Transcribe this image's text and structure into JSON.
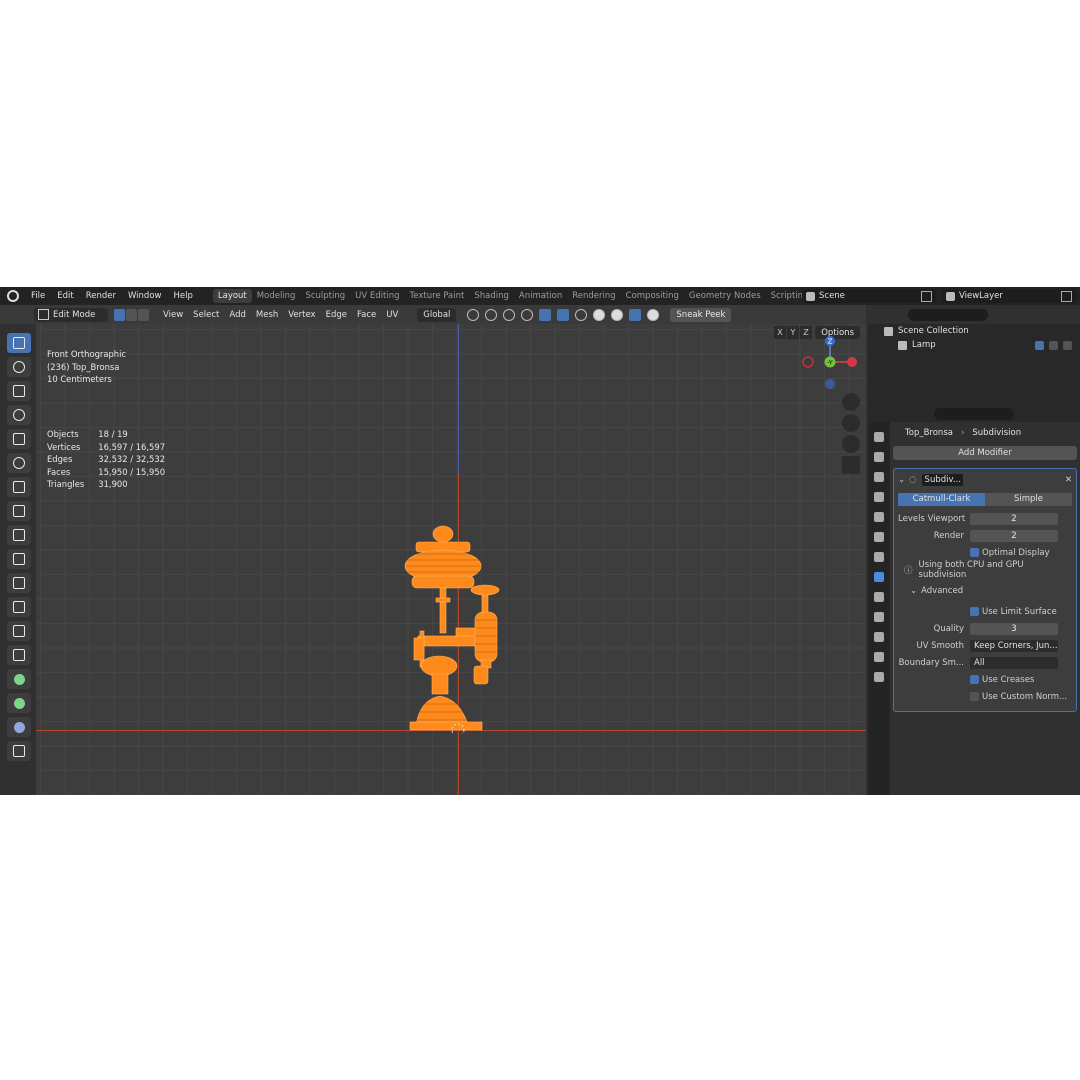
{
  "menu": {
    "items": [
      "File",
      "Edit",
      "Render",
      "Window",
      "Help"
    ]
  },
  "workspaces": [
    "Layout",
    "Modeling",
    "Sculpting",
    "UV Editing",
    "Texture Paint",
    "Shading",
    "Animation",
    "Rendering",
    "Compositing",
    "Geometry Nodes",
    "Scripting"
  ],
  "scene": {
    "name": "Scene"
  },
  "view_layer": {
    "name": "ViewLayer"
  },
  "header": {
    "mode": "Edit Mode",
    "menus": [
      "View",
      "Select",
      "Add",
      "Mesh",
      "Vertex",
      "Edge",
      "Face",
      "UV"
    ],
    "orientation": "Global",
    "sneak_peek": "Sneak Peek",
    "options": "Options",
    "axes": [
      "X",
      "Y",
      "Z"
    ]
  },
  "viewport": {
    "view_name": "Front Orthographic",
    "object": "(236) Top_Bronsa",
    "scale": "10 Centimeters",
    "stats": [
      {
        "label": "Objects",
        "value": "18 / 19"
      },
      {
        "label": "Vertices",
        "value": "16,597 / 16,597"
      },
      {
        "label": "Edges",
        "value": "32,532 / 32,532"
      },
      {
        "label": "Faces",
        "value": "15,950 / 15,950"
      },
      {
        "label": "Triangles",
        "value": "31,900"
      }
    ],
    "gizmo": {
      "z": "Z",
      "y": "-Y"
    },
    "selection_color": "#ff8a1c"
  },
  "outliner": {
    "collection": "Scene Collection",
    "item": "Lamp"
  },
  "properties": {
    "object": "Top_Bronsa",
    "modifier_crumb": "Subdivision",
    "add_modifier": "Add Modifier",
    "modifier_name": "Subdiv...",
    "type_catmull": "Catmull-Clark",
    "type_simple": "Simple",
    "levels_viewport_label": "Levels Viewport",
    "levels_viewport": "2",
    "render_label": "Render",
    "render": "2",
    "optimal_display": "Optimal Display",
    "info": "Using both CPU and GPU subdivision",
    "advanced": "Advanced",
    "use_limit_surface": "Use Limit Surface",
    "quality_label": "Quality",
    "quality": "3",
    "uv_smooth_label": "UV Smooth",
    "uv_smooth": "Keep Corners, Jun...",
    "boundary_label": "Boundary Sm...",
    "boundary": "All",
    "use_creases": "Use Creases",
    "use_custom_normals": "Use Custom Norm..."
  },
  "colors": {
    "accent": "#4772b3",
    "bg": "#303030"
  }
}
